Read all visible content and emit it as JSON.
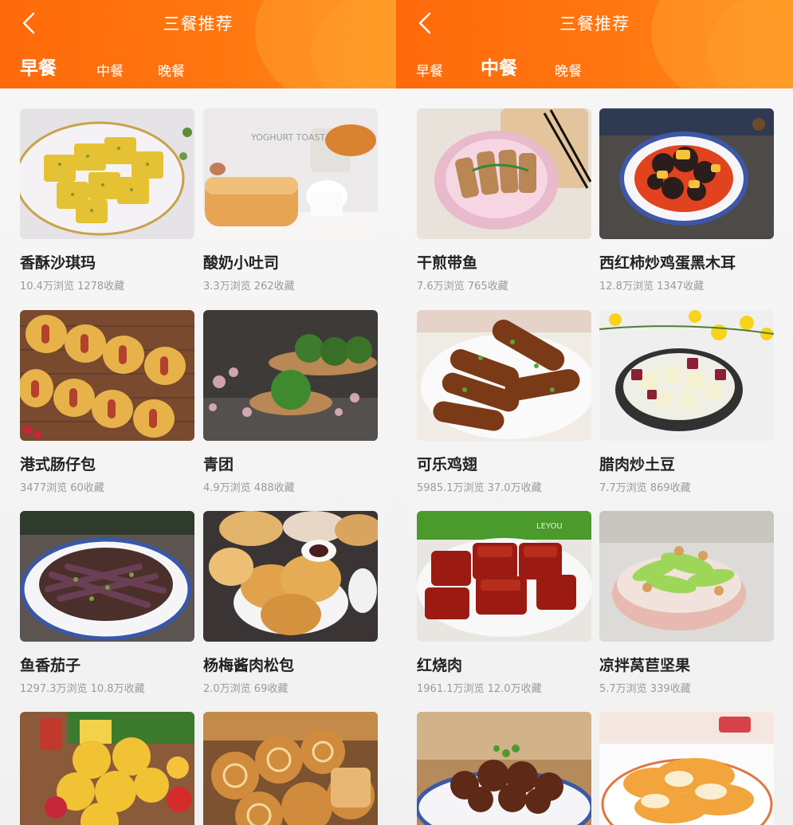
{
  "screens": [
    {
      "title": "三餐推荐",
      "tabs": [
        "早餐",
        "中餐",
        "晚餐"
      ],
      "active_tab": 0,
      "cards": [
        {
          "name": "香酥沙琪玛",
          "stats": "10.4万浏览 1278收藏",
          "photo_text": ""
        },
        {
          "name": "酸奶小吐司",
          "stats": "3.3万浏览 262收藏",
          "photo_text": "YOGHURT TOAST"
        },
        {
          "name": "港式肠仔包",
          "stats": "3477浏览 60收藏",
          "photo_text": ""
        },
        {
          "name": "青团",
          "stats": "4.9万浏览 488收藏",
          "photo_text": ""
        },
        {
          "name": "鱼香茄子",
          "stats": "1297.3万浏览 10.8万收藏",
          "photo_text": ""
        },
        {
          "name": "杨梅酱肉松包",
          "stats": "2.0万浏览 69收藏",
          "photo_text": ""
        },
        {
          "name": "",
          "stats": "",
          "photo_text": ""
        },
        {
          "name": "",
          "stats": "",
          "photo_text": ""
        }
      ]
    },
    {
      "title": "三餐推荐",
      "tabs": [
        "早餐",
        "中餐",
        "晚餐"
      ],
      "active_tab": 1,
      "cards": [
        {
          "name": "干煎带鱼",
          "stats": "7.6万浏览 765收藏",
          "photo_text": ""
        },
        {
          "name": "西红柿炒鸡蛋黑木耳",
          "stats": "12.8万浏览 1347收藏",
          "photo_text": ""
        },
        {
          "name": "可乐鸡翅",
          "stats": "5985.1万浏览 37.0万收藏",
          "photo_text": ""
        },
        {
          "name": "腊肉炒土豆",
          "stats": "7.7万浏览 869收藏",
          "photo_text": ""
        },
        {
          "name": "红烧肉",
          "stats": "1961.1万浏览 12.0万收藏",
          "photo_text": "LEYOU"
        },
        {
          "name": "凉拌莴苣坚果",
          "stats": "5.7万浏览 339收藏",
          "photo_text": ""
        },
        {
          "name": "",
          "stats": "",
          "photo_text": ""
        },
        {
          "name": "",
          "stats": "",
          "photo_text": ""
        }
      ]
    }
  ],
  "colors": {
    "header": "#ff6f0e",
    "text": "#222222",
    "meta": "#9a9a9a"
  },
  "icons": {
    "back": "chevron-left-icon"
  }
}
